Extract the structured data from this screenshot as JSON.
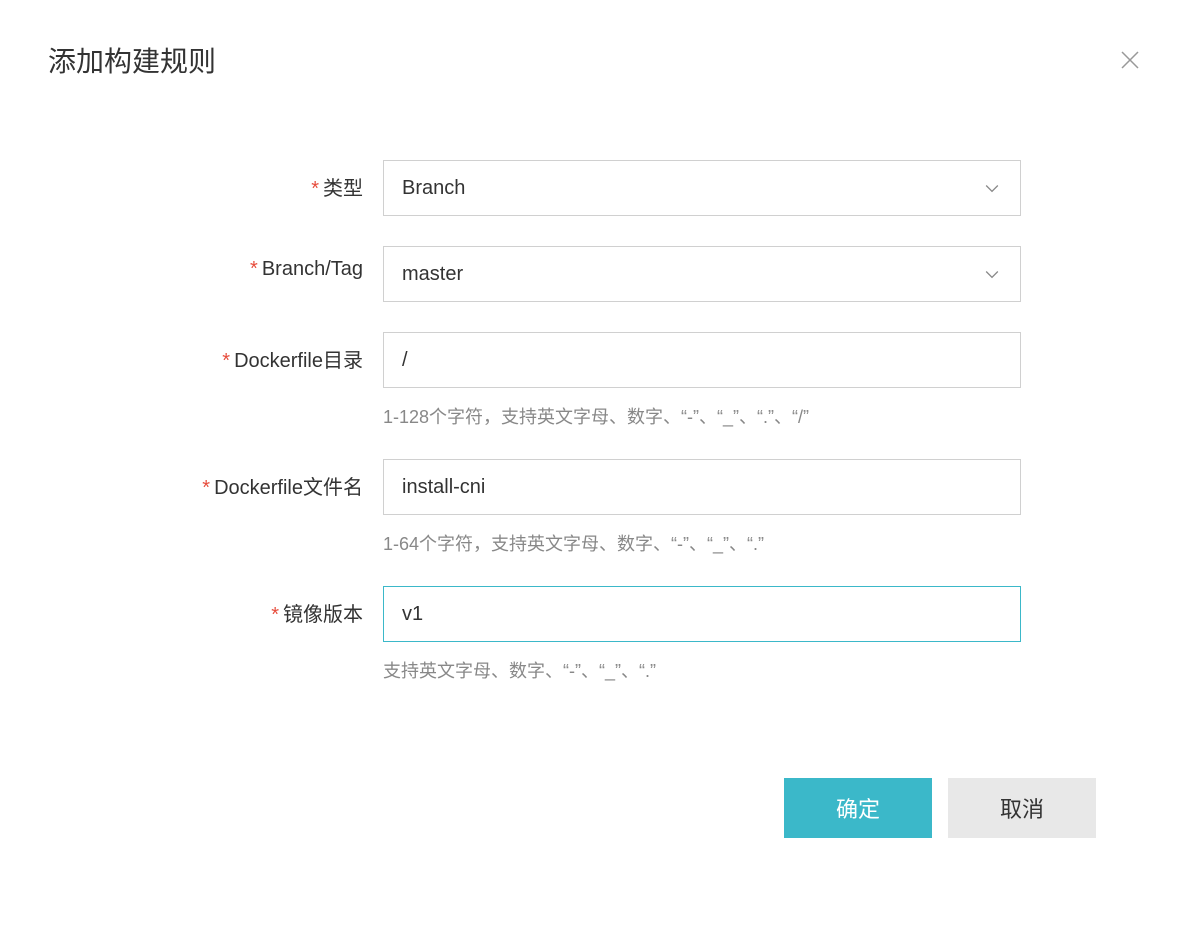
{
  "dialog": {
    "title": "添加构建规则"
  },
  "form": {
    "type": {
      "label": "类型",
      "value": "Branch"
    },
    "branch_tag": {
      "label": "Branch/Tag",
      "value": "master"
    },
    "dockerfile_dir": {
      "label": "Dockerfile目录",
      "value": "/",
      "hint": "1-128个字符，支持英文字母、数字、“-”、“_”、“.”、“/”"
    },
    "dockerfile_name": {
      "label": "Dockerfile文件名",
      "value": "install-cni",
      "hint": "1-64个字符，支持英文字母、数字、“-”、“_”、“.”"
    },
    "image_version": {
      "label": "镜像版本",
      "value": "v1",
      "hint": "支持英文字母、数字、“-”、“_”、“.”"
    }
  },
  "buttons": {
    "confirm": "确定",
    "cancel": "取消"
  }
}
